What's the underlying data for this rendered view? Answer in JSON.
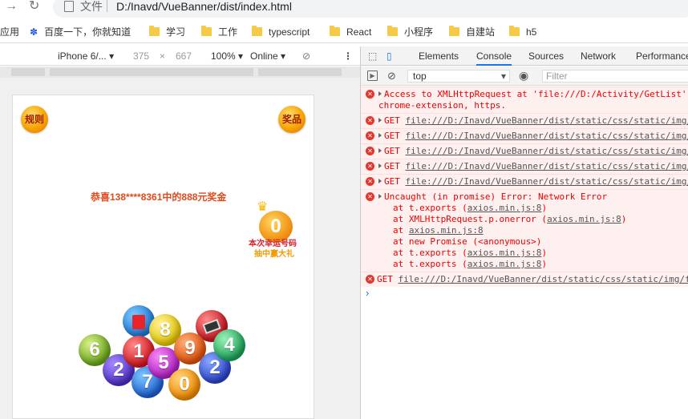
{
  "browser": {
    "url_scheme_label": "文件",
    "url": "D:/Inavd/VueBanner/dist/index.html"
  },
  "bookmarks": {
    "apps_label": "应用",
    "items": [
      {
        "label": "百度一下，你就知道"
      },
      {
        "label": "学习"
      },
      {
        "label": "工作"
      },
      {
        "label": "typescript"
      },
      {
        "label": "React"
      },
      {
        "label": "小程序"
      },
      {
        "label": "自建站"
      },
      {
        "label": "h5"
      }
    ]
  },
  "device_toolbar": {
    "device": "iPhone 6/...",
    "width": "375",
    "times": "×",
    "height": "667",
    "zoom": "100%",
    "network": "Online"
  },
  "page": {
    "rules_label": "规则",
    "prize_label": "奖品",
    "congrats": "恭喜138****8361中的888元奖金",
    "lucky_number": "0",
    "lucky_line1": "本次幸运号码",
    "lucky_line2": "抽中赢大礼",
    "balls": [
      "6",
      "2",
      "7",
      "1",
      "5",
      "0",
      "8",
      "9",
      "2",
      "4"
    ]
  },
  "devtools": {
    "tabs": [
      "Elements",
      "Console",
      "Sources",
      "Network",
      "Performance"
    ],
    "active_tab": "Console",
    "context": "top",
    "filter_placeholder": "Filter",
    "messages": [
      {
        "line1": "Access to XMLHttpRequest at 'file:///D:/Activity/GetList' from",
        "line2": "chrome-extension, https."
      },
      {
        "method": "GET",
        "url": "file:///D:/Inavd/VueBanner/dist/static/css/static/img/"
      },
      {
        "method": "GET",
        "url": "file:///D:/Inavd/VueBanner/dist/static/css/static/img/"
      },
      {
        "method": "GET",
        "url": "file:///D:/Inavd/VueBanner/dist/static/css/static/img/"
      },
      {
        "method": "GET",
        "url": "file:///D:/Inavd/VueBanner/dist/static/css/static/img/"
      },
      {
        "method": "GET",
        "url": "file:///D:/Inavd/VueBanner/dist/static/css/static/img/"
      },
      {
        "head": "Uncaught (in promise) Error: Network Error",
        "stack": [
          {
            "pre": "at t.exports (",
            "link": "axios.min.js:8",
            "post": ")"
          },
          {
            "pre": "at XMLHttpRequest.p.onerror (",
            "link": "axios.min.js:8",
            "post": ")"
          },
          {
            "pre": "at ",
            "link": "axios.min.js:8",
            "post": ""
          },
          {
            "pre": "at new Promise (<anonymous>)",
            "link": "",
            "post": ""
          },
          {
            "pre": "at t.exports (",
            "link": "axios.min.js:8",
            "post": ")"
          },
          {
            "pre": "at t.exports (",
            "link": "axios.min.js:8",
            "post": ")"
          }
        ]
      },
      {
        "method": "GET",
        "url": "file:///D:/Inavd/VueBanner/dist/static/css/static/img/f"
      }
    ],
    "prompt": "›"
  },
  "colors": {
    "accent": "#1a73e8",
    "error": "#e0382e",
    "congrats": "#e04a1c"
  }
}
